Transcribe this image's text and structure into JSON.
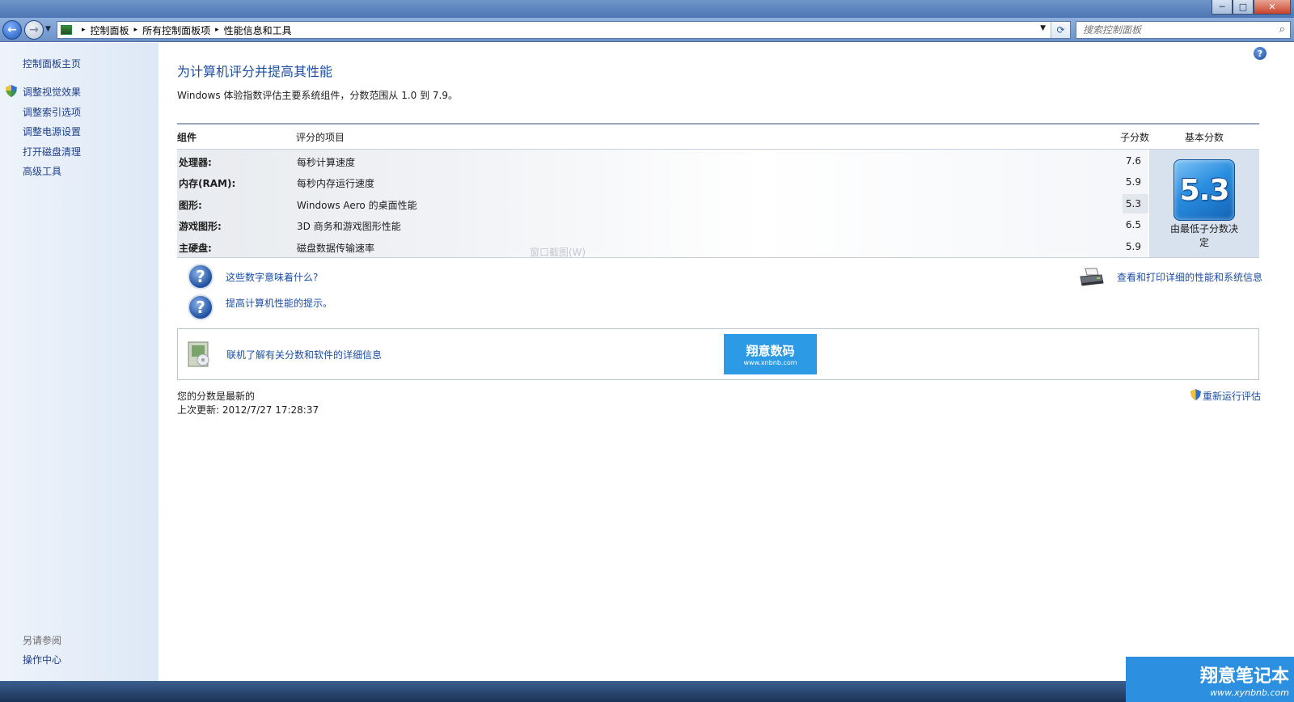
{
  "window": {
    "caption": {
      "minimize": "─",
      "maximize": "□",
      "close": "✕"
    }
  },
  "nav": {
    "back_glyph": "←",
    "forward_glyph": "→",
    "recent_glyph": "▼",
    "breadcrumbs": [
      "控制面板",
      "所有控制面板项",
      "性能信息和工具"
    ],
    "separator": "▸",
    "dropdown_glyph": "▼",
    "refresh_glyph": "⟳",
    "search_placeholder": "搜索控制面板",
    "search_glyph": "⌕"
  },
  "sidebar": {
    "home": "控制面板主页",
    "items": [
      "调整视觉效果",
      "调整索引选项",
      "调整电源设置",
      "打开磁盘清理",
      "高级工具"
    ],
    "see_also_title": "另请参阅",
    "see_also_items": [
      "操作中心"
    ]
  },
  "main": {
    "help_glyph": "?",
    "title": "为计算机评分并提高其性能",
    "subtitle": "Windows 体验指数评估主要系统组件，分数范围从 1.0 到 7.9。",
    "table": {
      "headers": {
        "component": "组件",
        "item": "评分的项目",
        "subscore": "子分数",
        "basescore": "基本分数"
      },
      "rows": [
        {
          "component": "处理器:",
          "item": "每秒计算速度",
          "subscore": "7.6"
        },
        {
          "component": "内存(RAM):",
          "item": "每秒内存运行速度",
          "subscore": "5.9"
        },
        {
          "component": "图形:",
          "item": "Windows Aero 的桌面性能",
          "subscore": "5.3"
        },
        {
          "component": "游戏图形:",
          "item": "3D 商务和游戏图形性能",
          "subscore": "6.5"
        },
        {
          "component": "主硬盘:",
          "item": "磁盘数据传输速率",
          "subscore": "5.9"
        }
      ],
      "base_score": "5.3",
      "base_note": "由最低子分数决定"
    },
    "ghost_overlay": "窗口截图(W)",
    "help_links": [
      "这些数字意味着什么?",
      "提高计算机性能的提示。"
    ],
    "print_link": "查看和打印详细的性能和系统信息",
    "online_link": "联机了解有关分数和软件的详细信息",
    "watermark": {
      "text": "翔意数码",
      "url": "www.xnbnb.com"
    },
    "status": {
      "line1": "您的分数是最新的",
      "line2": "上次更新: 2012/7/27 17:28:37"
    },
    "rerun_link": "重新运行评估"
  },
  "corner_watermark": {
    "text": "翔意笔记本",
    "url": "www.xynbnb.com"
  }
}
